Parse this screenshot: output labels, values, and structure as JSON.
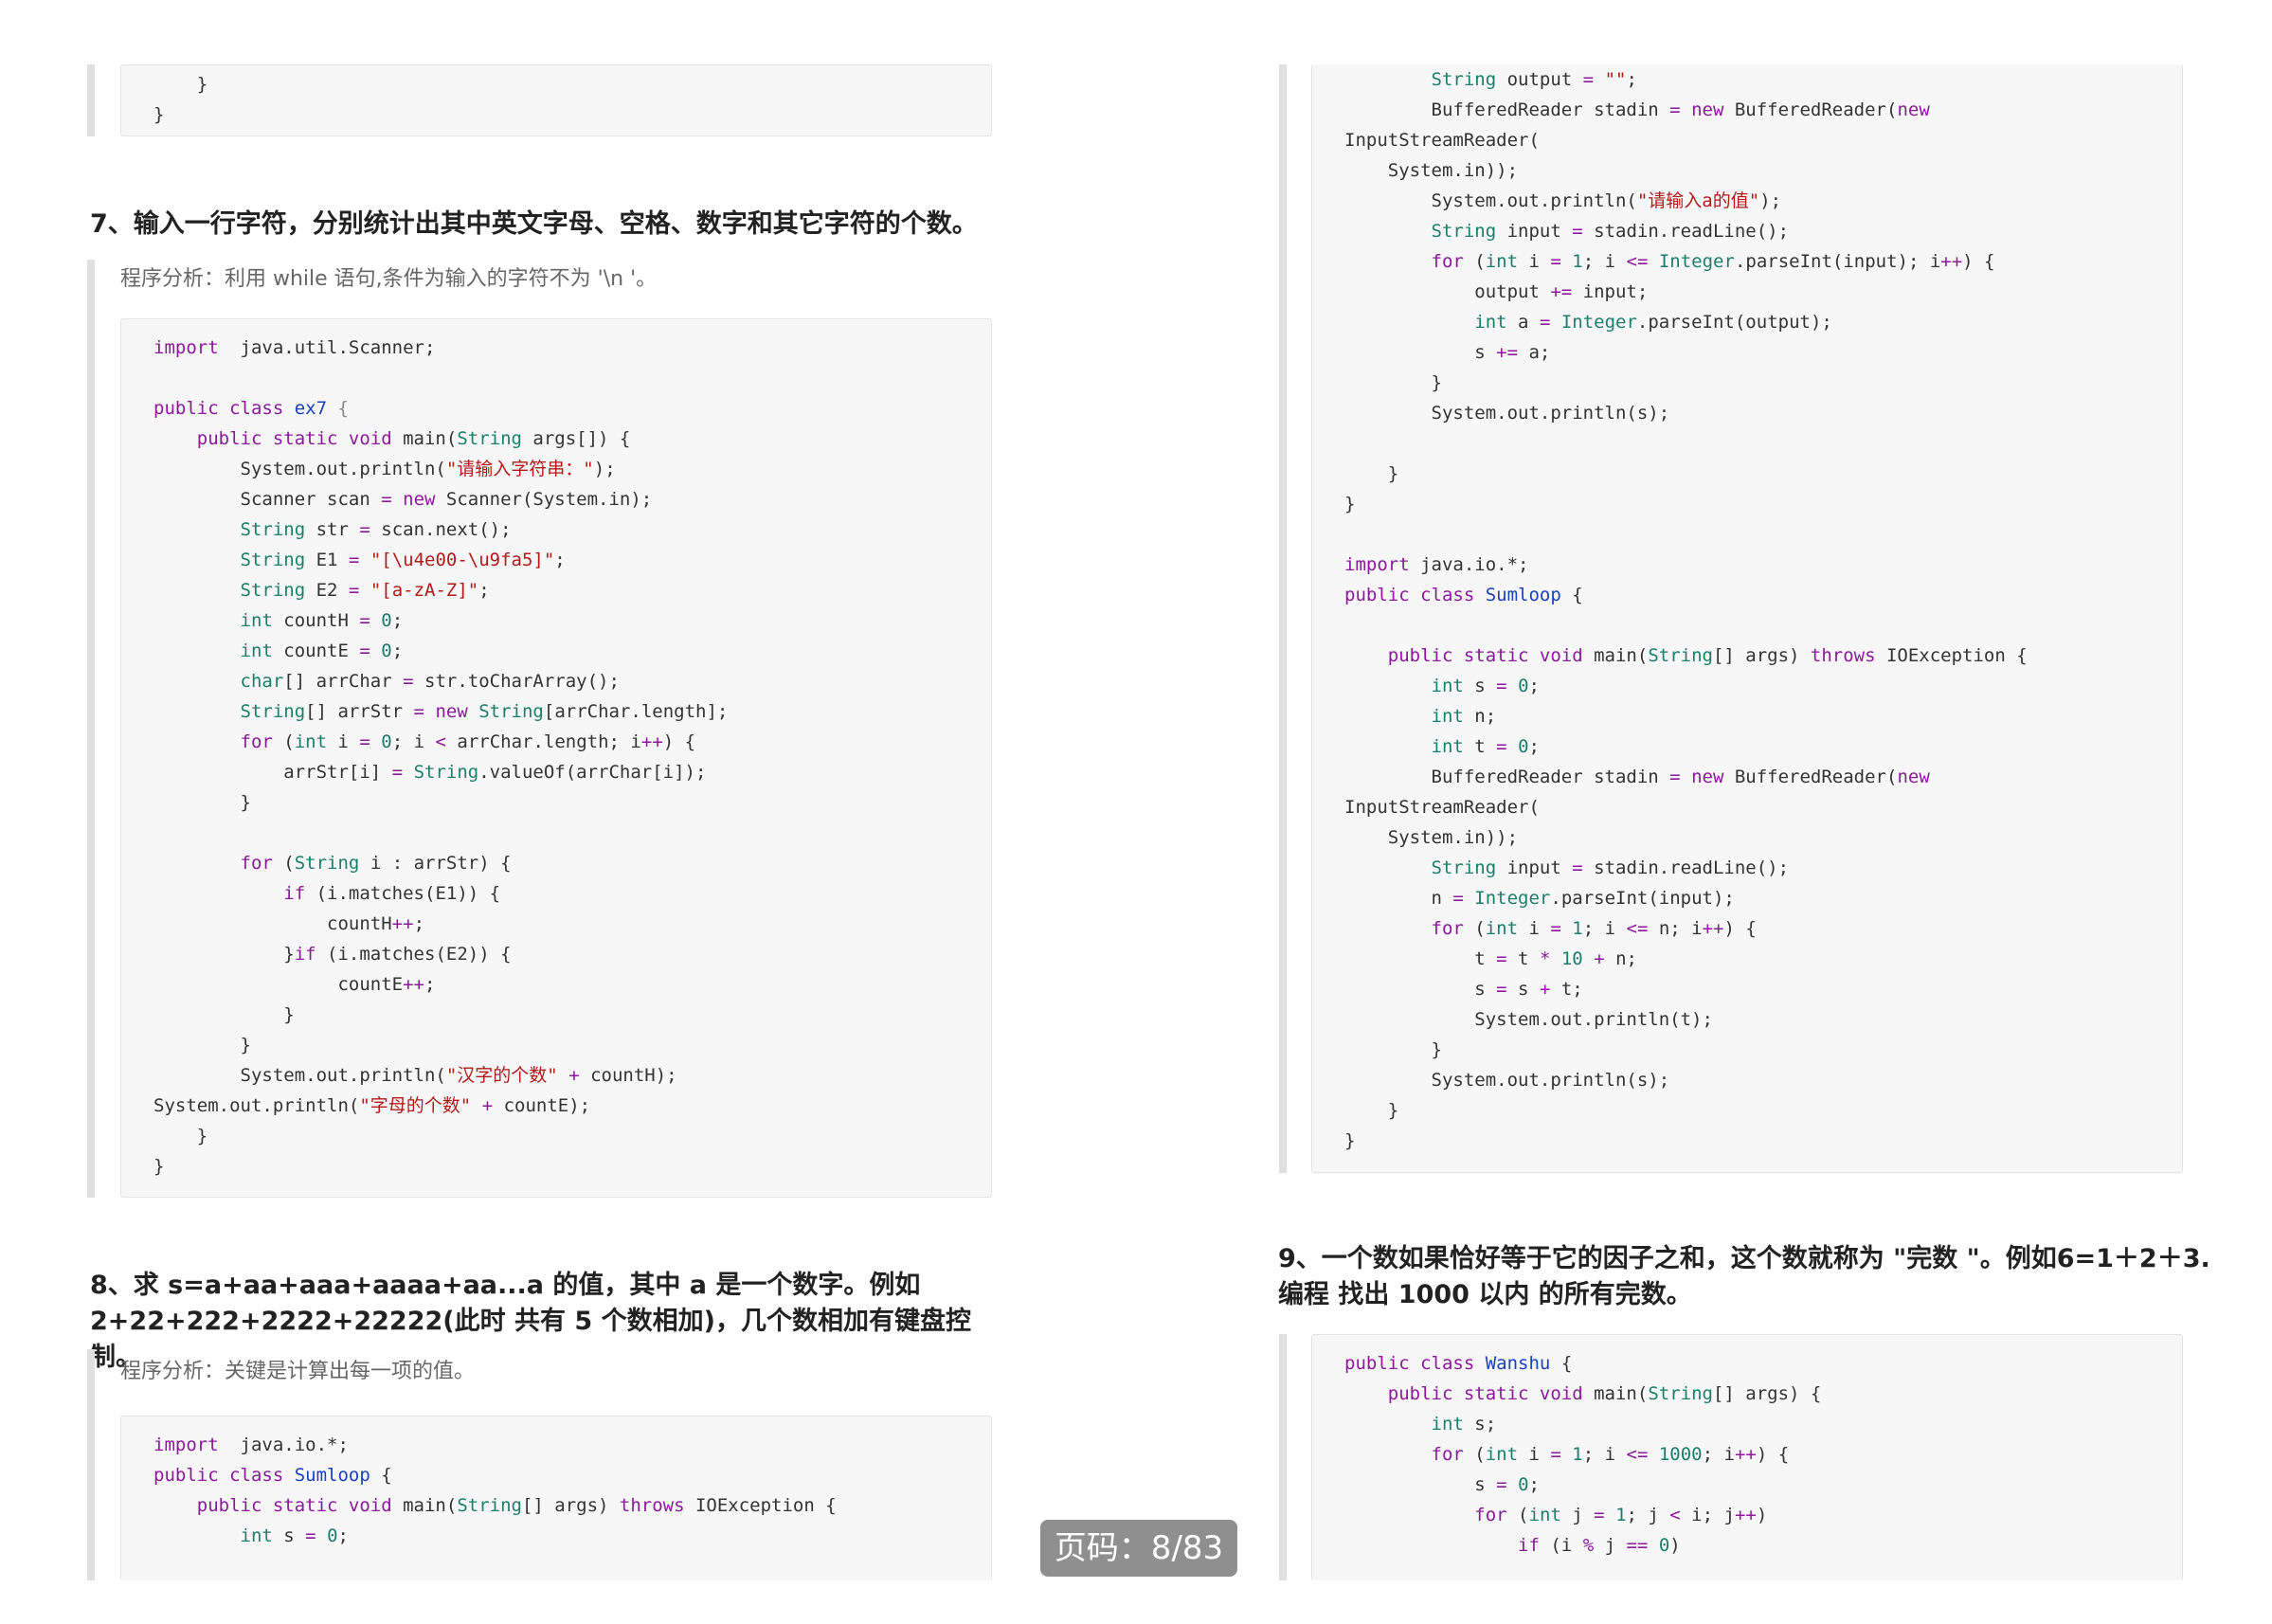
{
  "left": {
    "top_code_tail": [
      "    }",
      "}"
    ],
    "q7": {
      "heading": "7、输入一行字符，分别统计出其中英文字母、空格、数字和其它字符的个数。",
      "analysis": "程序分析：利用 while 语句,条件为输入的字符不为 '\\n '。"
    },
    "q8": {
      "heading_line1": "8、求 s=a+aa+aaa+aaaa+aa...a 的值，其中 a 是一个数字。例如",
      "heading_line2": "2+22+222+2222+22222(此时 共有 5 个数相加)，几个数相加有键盘控制。",
      "analysis": "程序分析：关键是计算出每一项的值。"
    }
  },
  "right": {
    "q9": {
      "heading_line1": "9、一个数如果恰好等于它的因子之和，这个数就称为 \"完数 \"。例如6=1＋2＋3.",
      "heading_line2": "编程 找出 1000 以内 的所有完数。"
    }
  },
  "code": {
    "ex7": [
      [
        [
          "kw",
          "import"
        ],
        [
          "",
          "  java.util.Scanner;"
        ]
      ],
      [],
      [
        [
          "kw",
          "public class"
        ],
        [
          "",
          " "
        ],
        [
          "cl",
          "ex7"
        ],
        [
          "pu",
          " {"
        ]
      ],
      [
        [
          "",
          "    "
        ],
        [
          "kw",
          "public static void"
        ],
        [
          "",
          " main("
        ],
        [
          "ty",
          "String"
        ],
        [
          "",
          " args[]) {"
        ]
      ],
      [
        [
          "",
          "        System.out.println("
        ],
        [
          "st",
          "\"请输入字符串：\""
        ],
        [
          "",
          ");"
        ]
      ],
      [
        [
          "",
          "        Scanner scan "
        ],
        [
          "op",
          "="
        ],
        [
          "",
          " "
        ],
        [
          "kw",
          "new"
        ],
        [
          "",
          " Scanner(System.in);"
        ]
      ],
      [
        [
          "",
          "        "
        ],
        [
          "ty",
          "String"
        ],
        [
          "",
          " str "
        ],
        [
          "op",
          "="
        ],
        [
          "",
          " scan.next();"
        ]
      ],
      [
        [
          "",
          "        "
        ],
        [
          "ty",
          "String"
        ],
        [
          "",
          " E1 "
        ],
        [
          "op",
          "="
        ],
        [
          "",
          " "
        ],
        [
          "st",
          "\"[\\u4e00-\\u9fa5]\""
        ],
        [
          "",
          ";"
        ]
      ],
      [
        [
          "",
          "        "
        ],
        [
          "ty",
          "String"
        ],
        [
          "",
          " E2 "
        ],
        [
          "op",
          "="
        ],
        [
          "",
          " "
        ],
        [
          "st",
          "\"[a-zA-Z]\""
        ],
        [
          "",
          ";"
        ]
      ],
      [
        [
          "",
          "        "
        ],
        [
          "ty",
          "int"
        ],
        [
          "",
          " countH "
        ],
        [
          "op",
          "="
        ],
        [
          "",
          " "
        ],
        [
          "nu",
          "0"
        ],
        [
          "",
          ";"
        ]
      ],
      [
        [
          "",
          "        "
        ],
        [
          "ty",
          "int"
        ],
        [
          "",
          " countE "
        ],
        [
          "op",
          "="
        ],
        [
          "",
          " "
        ],
        [
          "nu",
          "0"
        ],
        [
          "",
          ";"
        ]
      ],
      [
        [
          "",
          "        "
        ],
        [
          "ty",
          "char"
        ],
        [
          "",
          "[] arrChar "
        ],
        [
          "op",
          "="
        ],
        [
          "",
          " str.toCharArray();"
        ]
      ],
      [
        [
          "",
          "        "
        ],
        [
          "ty",
          "String"
        ],
        [
          "",
          "[] arrStr "
        ],
        [
          "op",
          "="
        ],
        [
          "",
          " "
        ],
        [
          "kw",
          "new"
        ],
        [
          "",
          " "
        ],
        [
          "ty",
          "String"
        ],
        [
          "",
          "[arrChar.length];"
        ]
      ],
      [
        [
          "",
          "        "
        ],
        [
          "kw",
          "for"
        ],
        [
          "",
          " ("
        ],
        [
          "ty",
          "int"
        ],
        [
          "",
          " i "
        ],
        [
          "op",
          "="
        ],
        [
          "",
          " "
        ],
        [
          "nu",
          "0"
        ],
        [
          "",
          "; i "
        ],
        [
          "op",
          "<"
        ],
        [
          "",
          " arrChar.length; i"
        ],
        [
          "op",
          "++"
        ],
        [
          "",
          ") {"
        ]
      ],
      [
        [
          "",
          "            arrStr[i] "
        ],
        [
          "op",
          "="
        ],
        [
          "",
          " "
        ],
        [
          "ty",
          "String"
        ],
        [
          "",
          ".valueOf(arrChar[i]);"
        ]
      ],
      [
        [
          "",
          "        }"
        ]
      ],
      [],
      [
        [
          "",
          "        "
        ],
        [
          "kw",
          "for"
        ],
        [
          "",
          " ("
        ],
        [
          "ty",
          "String"
        ],
        [
          "",
          " i : arrStr) {"
        ]
      ],
      [
        [
          "",
          "            "
        ],
        [
          "kw",
          "if"
        ],
        [
          "",
          " (i.matches(E1)) {"
        ]
      ],
      [
        [
          "",
          "                countH"
        ],
        [
          "op",
          "++"
        ],
        [
          "",
          ";"
        ]
      ],
      [
        [
          "",
          "            }"
        ],
        [
          "kw",
          "if"
        ],
        [
          "",
          " (i.matches(E2)) {"
        ]
      ],
      [
        [
          "",
          "                 countE"
        ],
        [
          "op",
          "++"
        ],
        [
          "",
          ";"
        ]
      ],
      [
        [
          "",
          "            }"
        ]
      ],
      [
        [
          "",
          "        }"
        ]
      ],
      [
        [
          "",
          "        System.out.println("
        ],
        [
          "st",
          "\"汉字的个数\""
        ],
        [
          "",
          " "
        ],
        [
          "op",
          "+"
        ],
        [
          "",
          " countH);"
        ]
      ],
      [
        [
          "",
          "System.out.println("
        ],
        [
          "st",
          "\"字母的个数\""
        ],
        [
          "",
          " "
        ],
        [
          "op",
          "+"
        ],
        [
          "",
          " countE);"
        ]
      ],
      [
        [
          "",
          "    }"
        ]
      ],
      [
        [
          "",
          "}"
        ]
      ]
    ],
    "ex8_left": [
      [
        [
          "kw",
          "import"
        ],
        [
          "",
          "  java.io.*;"
        ]
      ],
      [
        [
          "kw",
          "public class"
        ],
        [
          "",
          " "
        ],
        [
          "cl",
          "Sumloop"
        ],
        [
          "",
          " {"
        ]
      ],
      [
        [
          "",
          "    "
        ],
        [
          "kw",
          "public static void"
        ],
        [
          "",
          " main("
        ],
        [
          "ty",
          "String"
        ],
        [
          "",
          "[] args) "
        ],
        [
          "kw",
          "throws"
        ],
        [
          "",
          " IOException {"
        ]
      ],
      [
        [
          "",
          "        "
        ],
        [
          "ty",
          "int"
        ],
        [
          "",
          " s "
        ],
        [
          "op",
          "="
        ],
        [
          "",
          " "
        ],
        [
          "nu",
          "0"
        ],
        [
          "",
          ";"
        ]
      ]
    ],
    "right_top": [
      [
        [
          "",
          "        "
        ],
        [
          "ty",
          "String"
        ],
        [
          "",
          " output "
        ],
        [
          "op",
          "="
        ],
        [
          "",
          " "
        ],
        [
          "st",
          "\"\""
        ],
        [
          "",
          ";"
        ]
      ],
      [
        [
          "",
          "        BufferedReader stadin "
        ],
        [
          "op",
          "="
        ],
        [
          "",
          " "
        ],
        [
          "kw",
          "new"
        ],
        [
          "",
          " BufferedReader("
        ],
        [
          "kw",
          "new"
        ]
      ],
      [
        [
          "",
          "InputStreamReader("
        ]
      ],
      [
        [
          "",
          "    System.in));"
        ]
      ],
      [
        [
          "",
          "        System.out.println("
        ],
        [
          "st",
          "\"请输入a的值\""
        ],
        [
          "",
          ");"
        ]
      ],
      [
        [
          "",
          "        "
        ],
        [
          "ty",
          "String"
        ],
        [
          "",
          " input "
        ],
        [
          "op",
          "="
        ],
        [
          "",
          " stadin.readLine();"
        ]
      ],
      [
        [
          "",
          "        "
        ],
        [
          "kw",
          "for"
        ],
        [
          "",
          " ("
        ],
        [
          "ty",
          "int"
        ],
        [
          "",
          " i "
        ],
        [
          "op",
          "="
        ],
        [
          "",
          " "
        ],
        [
          "nu",
          "1"
        ],
        [
          "",
          "; i "
        ],
        [
          "op",
          "<="
        ],
        [
          "",
          " "
        ],
        [
          "ty",
          "Integer"
        ],
        [
          "",
          ".parseInt(input); i"
        ],
        [
          "op",
          "++"
        ],
        [
          "",
          ") {"
        ]
      ],
      [
        [
          "",
          "            output "
        ],
        [
          "op",
          "+="
        ],
        [
          "",
          " input;"
        ]
      ],
      [
        [
          "",
          "            "
        ],
        [
          "ty",
          "int"
        ],
        [
          "",
          " a "
        ],
        [
          "op",
          "="
        ],
        [
          "",
          " "
        ],
        [
          "ty",
          "Integer"
        ],
        [
          "",
          ".parseInt(output);"
        ]
      ],
      [
        [
          "",
          "            s "
        ],
        [
          "op",
          "+="
        ],
        [
          "",
          " a;"
        ]
      ],
      [
        [
          "",
          "        }"
        ]
      ],
      [
        [
          "",
          "        System.out.println(s);"
        ]
      ],
      [],
      [
        [
          "",
          "    }"
        ]
      ],
      [
        [
          "",
          "}"
        ]
      ],
      [],
      [
        [
          "kw",
          "import"
        ],
        [
          "",
          " java.io.*;"
        ]
      ],
      [
        [
          "kw",
          "public class"
        ],
        [
          "",
          " "
        ],
        [
          "cl",
          "Sumloop"
        ],
        [
          "",
          " {"
        ]
      ],
      [],
      [
        [
          "",
          "    "
        ],
        [
          "kw",
          "public static void"
        ],
        [
          "",
          " main("
        ],
        [
          "ty",
          "String"
        ],
        [
          "",
          "[] args) "
        ],
        [
          "kw",
          "throws"
        ],
        [
          "",
          " IOException {"
        ]
      ],
      [
        [
          "",
          "        "
        ],
        [
          "ty",
          "int"
        ],
        [
          "",
          " s "
        ],
        [
          "op",
          "="
        ],
        [
          "",
          " "
        ],
        [
          "nu",
          "0"
        ],
        [
          "",
          ";"
        ]
      ],
      [
        [
          "",
          "        "
        ],
        [
          "ty",
          "int"
        ],
        [
          "",
          " n;"
        ]
      ],
      [
        [
          "",
          "        "
        ],
        [
          "ty",
          "int"
        ],
        [
          "",
          " t "
        ],
        [
          "op",
          "="
        ],
        [
          "",
          " "
        ],
        [
          "nu",
          "0"
        ],
        [
          "",
          ";"
        ]
      ],
      [
        [
          "",
          "        BufferedReader stadin "
        ],
        [
          "op",
          "="
        ],
        [
          "",
          " "
        ],
        [
          "kw",
          "new"
        ],
        [
          "",
          " BufferedReader("
        ],
        [
          "kw",
          "new"
        ]
      ],
      [
        [
          "",
          "InputStreamReader("
        ]
      ],
      [
        [
          "",
          "    System.in));"
        ]
      ],
      [
        [
          "",
          "        "
        ],
        [
          "ty",
          "String"
        ],
        [
          "",
          " input "
        ],
        [
          "op",
          "="
        ],
        [
          "",
          " stadin.readLine();"
        ]
      ],
      [
        [
          "",
          "        n "
        ],
        [
          "op",
          "="
        ],
        [
          "",
          " "
        ],
        [
          "ty",
          "Integer"
        ],
        [
          "",
          ".parseInt(input);"
        ]
      ],
      [
        [
          "",
          "        "
        ],
        [
          "kw",
          "for"
        ],
        [
          "",
          " ("
        ],
        [
          "ty",
          "int"
        ],
        [
          "",
          " i "
        ],
        [
          "op",
          "="
        ],
        [
          "",
          " "
        ],
        [
          "nu",
          "1"
        ],
        [
          "",
          "; i "
        ],
        [
          "op",
          "<="
        ],
        [
          "",
          " n; i"
        ],
        [
          "op",
          "++"
        ],
        [
          "",
          ") {"
        ]
      ],
      [
        [
          "",
          "            t "
        ],
        [
          "op",
          "="
        ],
        [
          "",
          " t "
        ],
        [
          "op",
          "*"
        ],
        [
          "",
          " "
        ],
        [
          "nu",
          "10"
        ],
        [
          "",
          " "
        ],
        [
          "op",
          "+"
        ],
        [
          "",
          " n;"
        ]
      ],
      [
        [
          "",
          "            s "
        ],
        [
          "op",
          "="
        ],
        [
          "",
          " s "
        ],
        [
          "op",
          "+"
        ],
        [
          "",
          " t;"
        ]
      ],
      [
        [
          "",
          "            System.out.println(t);"
        ]
      ],
      [
        [
          "",
          "        }"
        ]
      ],
      [
        [
          "",
          "        System.out.println(s);"
        ]
      ],
      [
        [
          "",
          "    }"
        ]
      ],
      [
        [
          "",
          "}"
        ]
      ]
    ],
    "ex9": [
      [
        [
          "kw",
          "public class"
        ],
        [
          "",
          " "
        ],
        [
          "cl",
          "Wanshu"
        ],
        [
          "",
          " {"
        ]
      ],
      [
        [
          "",
          "    "
        ],
        [
          "kw",
          "public static void"
        ],
        [
          "",
          " main("
        ],
        [
          "ty",
          "String"
        ],
        [
          "",
          "[] args) {"
        ]
      ],
      [
        [
          "",
          "        "
        ],
        [
          "ty",
          "int"
        ],
        [
          "",
          " s;"
        ]
      ],
      [
        [
          "",
          "        "
        ],
        [
          "kw",
          "for"
        ],
        [
          "",
          " ("
        ],
        [
          "ty",
          "int"
        ],
        [
          "",
          " i "
        ],
        [
          "op",
          "="
        ],
        [
          "",
          " "
        ],
        [
          "nu",
          "1"
        ],
        [
          "",
          "; i "
        ],
        [
          "op",
          "<="
        ],
        [
          "",
          " "
        ],
        [
          "nu",
          "1000"
        ],
        [
          "",
          "; i"
        ],
        [
          "op",
          "++"
        ],
        [
          "",
          ") {"
        ]
      ],
      [
        [
          "",
          "            s "
        ],
        [
          "op",
          "="
        ],
        [
          "",
          " "
        ],
        [
          "nu",
          "0"
        ],
        [
          "",
          ";"
        ]
      ],
      [
        [
          "",
          "            "
        ],
        [
          "kw",
          "for"
        ],
        [
          "",
          " ("
        ],
        [
          "ty",
          "int"
        ],
        [
          "",
          " j "
        ],
        [
          "op",
          "="
        ],
        [
          "",
          " "
        ],
        [
          "nu",
          "1"
        ],
        [
          "",
          "; j "
        ],
        [
          "op",
          "<"
        ],
        [
          "",
          " i; j"
        ],
        [
          "op",
          "++"
        ],
        [
          "",
          ")"
        ]
      ],
      [
        [
          "",
          "                "
        ],
        [
          "kw",
          "if"
        ],
        [
          "",
          " (i "
        ],
        [
          "op",
          "%"
        ],
        [
          "",
          " j "
        ],
        [
          "op",
          "=="
        ],
        [
          "",
          " "
        ],
        [
          "nu",
          "0"
        ],
        [
          "",
          ")"
        ]
      ]
    ]
  },
  "page_indicator": "页码：8/83"
}
